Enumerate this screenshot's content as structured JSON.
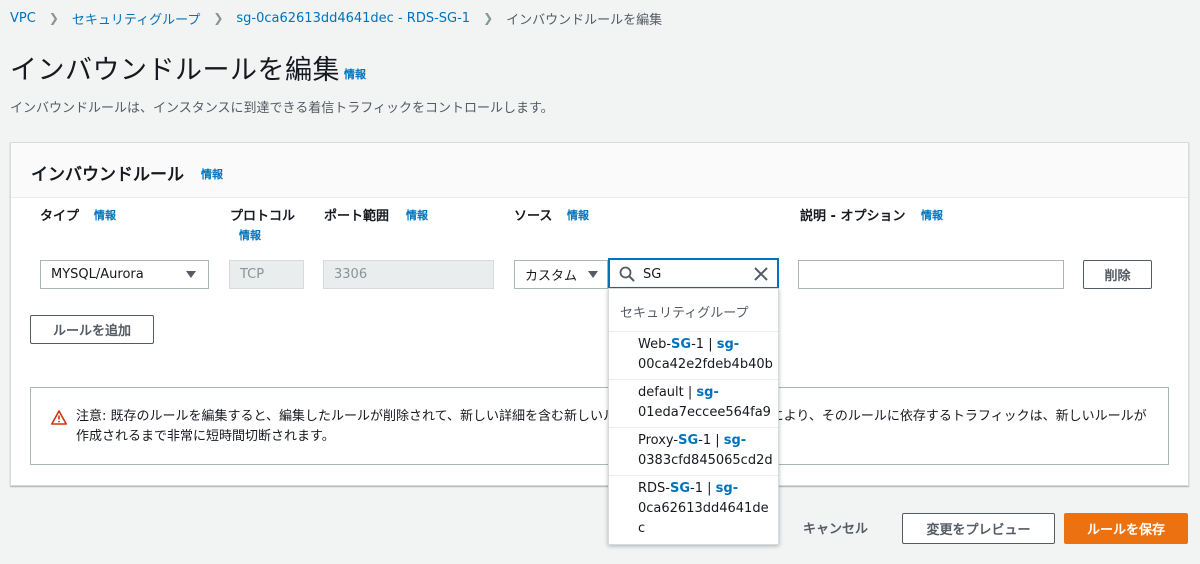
{
  "breadcrumb": {
    "items": [
      "VPC",
      "セキュリティグループ",
      "sg-0ca62613dd4641dec - RDS-SG-1"
    ],
    "current": "インバウンドルールを編集"
  },
  "page": {
    "title": "インバウンドルールを編集",
    "info": "情報",
    "description": "インバウンドルールは、インスタンスに到達できる着信トラフィックをコントロールします。"
  },
  "panel": {
    "title": "インバウンドルール",
    "info": "情報",
    "columns": {
      "type": "タイプ",
      "protocol": "プロトコル",
      "port_range": "ポート範囲",
      "source": "ソース",
      "description": "説明 - オプション",
      "info": "情報"
    },
    "rule": {
      "type": "MYSQL/Aurora",
      "protocol": "TCP",
      "port": "3306",
      "source_type": "カスタム",
      "source_search": "SG",
      "description": "",
      "delete": "削除"
    },
    "add_rule": "ルールを追加",
    "warning": "注意: 既存のルールを編集すると、編集したルールが削除されて、新しい詳細を含む新しいルールが作成されます。これにより、そのルールに依存するトラフィックは、新しいルールが作成されるまで非常に短時間切断されます。"
  },
  "dropdown": {
    "group_label": "セキュリティグループ",
    "items": [
      {
        "name_pre": "Web-",
        "name_hl": "SG",
        "name_post": "-1 | ",
        "id_hl": "sg",
        "id_post1": "-",
        "id_line2": "00ca42e2fdeb4b40b"
      },
      {
        "name_pre": "default | ",
        "name_hl": "",
        "name_post": "",
        "id_hl": "sg",
        "id_post1": "-",
        "id_line2": "01eda7eccee564fa9"
      },
      {
        "name_pre": "Proxy-",
        "name_hl": "SG",
        "name_post": "-1 | ",
        "id_hl": "sg",
        "id_post1": "-",
        "id_line2": "0383cfd845065cd2d"
      },
      {
        "name_pre": "RDS-",
        "name_hl": "SG",
        "name_post": "-1 | ",
        "id_hl": "sg",
        "id_post1": "-",
        "id_line2": "0ca62613dd4641de",
        "id_line3": "c"
      }
    ]
  },
  "footer": {
    "cancel": "キャンセル",
    "preview": "変更をプレビュー",
    "save": "ルールを保存"
  },
  "colors": {
    "accent": "#ec7211",
    "link": "#0073bb",
    "warning": "#d13212"
  }
}
